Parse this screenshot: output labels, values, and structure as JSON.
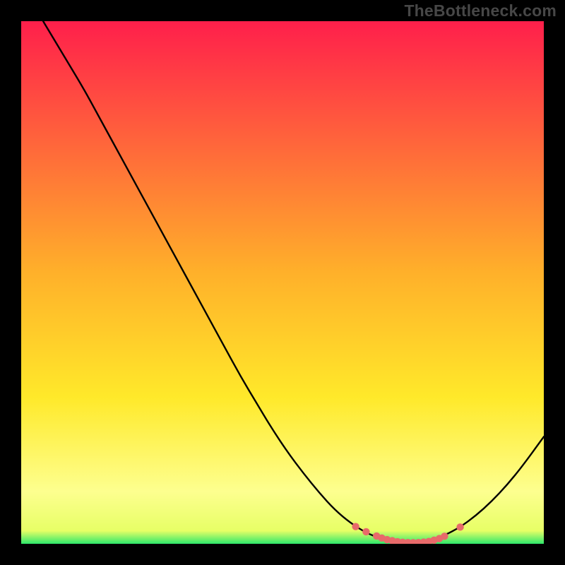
{
  "watermark": "TheBottleneck.com",
  "colors": {
    "background": "#000000",
    "curve": "#000000",
    "marker": "#e86a6a",
    "good_band": "#2ee86b",
    "gradient_top": "#ff1f4b",
    "gradient_mid": "#ffda2a",
    "gradient_low": "#fdff8f",
    "gradient_bottom": "#2ee86b"
  },
  "chart_data": {
    "type": "line",
    "title": "",
    "xlabel": "",
    "ylabel": "",
    "xlim": [
      0,
      100
    ],
    "ylim": [
      0,
      100
    ],
    "x": [
      0,
      3,
      6,
      9,
      12,
      15,
      18,
      21,
      24,
      27,
      30,
      33,
      36,
      39,
      42,
      45,
      48,
      51,
      54,
      57,
      60,
      63,
      66,
      69,
      72,
      75,
      78,
      81,
      84,
      87,
      90,
      93,
      96,
      100
    ],
    "values": [
      108,
      102,
      97,
      92,
      87,
      81.5,
      76,
      70.5,
      65,
      59.5,
      54,
      48.5,
      43,
      37.5,
      32,
      27,
      22,
      17.5,
      13.5,
      9.8,
      6.5,
      4,
      2.1,
      0.9,
      0.3,
      0.2,
      0.6,
      1.6,
      3.2,
      5.4,
      8.1,
      11.3,
      15,
      20.5
    ],
    "markers_x": [
      64,
      66,
      68,
      69,
      70,
      71,
      72,
      73,
      74,
      75,
      76,
      77,
      78,
      79,
      80,
      81,
      84
    ],
    "markers_y": [
      3.3,
      2.3,
      1.5,
      1.1,
      0.8,
      0.6,
      0.4,
      0.3,
      0.25,
      0.22,
      0.25,
      0.32,
      0.45,
      0.7,
      1.0,
      1.45,
      3.2
    ],
    "good_threshold_pct": 2.0
  }
}
